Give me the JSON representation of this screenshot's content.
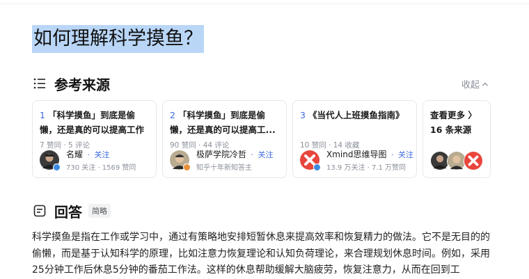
{
  "question": "如何理解科学摸鱼？",
  "sources": {
    "title": "参考来源",
    "collapse_label": "收起",
    "cards": [
      {
        "num": "1",
        "title": "「科学摸鱼」到底是偷懒，还是真的可以提高工作效...",
        "meta": "7 赞同 · 5 评论",
        "author": "名耀",
        "follow": "关注",
        "sub": "730 关注 · 1569 赞同"
      },
      {
        "num": "2",
        "title": "「科学摸鱼」到底是偷懒，还是真的可以提高工...",
        "meta": "90 赞同 · 44 评论",
        "author": "极萨学院冷哲",
        "follow": "关注",
        "sub": "知乎十年新知答主"
      },
      {
        "num": "3",
        "title": "《当代人上班摸鱼指南》",
        "meta": "10 赞同 · 14 收藏",
        "author": "Xmind思维导图",
        "follow": "关注",
        "sub": "13.9 万关注 · 7.1 万赞同"
      }
    ],
    "more": {
      "label": "查看更多 〉",
      "count": "16 条来源"
    }
  },
  "answer": {
    "title": "回答",
    "tag": "简略",
    "text": "科学摸鱼是指在工作或学习中，通过有策略地安排短暂休息来提高效率和恢复精力的做法。它不是无目的的偷懒，而是基于认知科学的原理，比如注意力恢复理论和认知负荷理论，来合理规划休息时间。例如，采用25分钟工作后休息5分钟的番茄工作法。这样的休息帮助缓解大脑疲劳，恢复注意力，从而在回到工"
  },
  "colors": {
    "highlight": "#b9d6f7",
    "link": "#3d6ae0",
    "muted": "#8a8f99",
    "xmind_red": "#e8453c"
  }
}
